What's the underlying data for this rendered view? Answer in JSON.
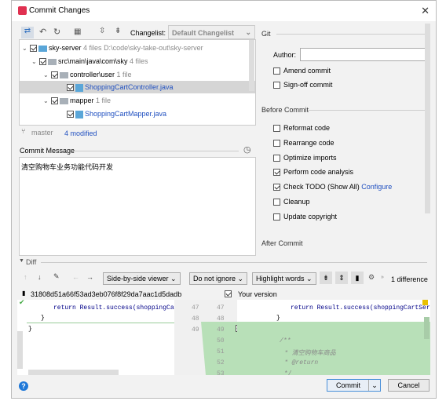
{
  "window": {
    "title": "Commit Changes"
  },
  "toolbar": {
    "changelist_label": "Changelist:",
    "changelist_value": "Default Changelist"
  },
  "tree": [
    {
      "name": "sky-server",
      "meta": "4 files",
      "path": "D:\\code\\sky-take-out\\sky-server"
    },
    {
      "name": "src\\main\\java\\com\\sky",
      "meta": "4 files"
    },
    {
      "name": "controller\\user",
      "meta": "1 file"
    },
    {
      "name": "ShoppingCartController.java"
    },
    {
      "name": "mapper",
      "meta": "1 file"
    },
    {
      "name": "ShoppingCartMapper.java"
    }
  ],
  "status": {
    "branch": "master",
    "modified": "4 modified"
  },
  "commit_message": {
    "label": "Commit Message",
    "value": "清空购物车业务功能代码开发"
  },
  "git": {
    "section": "Git",
    "author_label": "Author:",
    "author_value": "",
    "amend": "Amend commit",
    "signoff": "Sign-off commit"
  },
  "before_commit": {
    "section": "Before Commit",
    "options": [
      {
        "label": "Reformat code",
        "checked": false
      },
      {
        "label": "Rearrange code",
        "checked": false
      },
      {
        "label": "Optimize imports",
        "checked": false
      },
      {
        "label": "Perform code analysis",
        "checked": true
      },
      {
        "label": "Check TODO (Show All)",
        "checked": true,
        "link": "Configure"
      },
      {
        "label": "Cleanup",
        "checked": false
      },
      {
        "label": "Update copyright",
        "checked": false
      }
    ]
  },
  "after_commit": {
    "section": "After Commit"
  },
  "diff": {
    "section": "Diff",
    "viewer": "Side-by-side viewer",
    "ignore": "Do not ignore",
    "highlight": "Highlight words",
    "count": "1 difference",
    "left_title": "31808d51a66f53ad3eb076f8f29da7aac1d5dadb",
    "right_title": "Your version",
    "left_lines": [
      "return Result.success(shoppingCartSer",
      "}",
      "}"
    ],
    "left_nums": [
      "47",
      "48",
      "49"
    ],
    "right_nums": [
      "47",
      "48",
      "49",
      "50",
      "51",
      "52",
      "53"
    ],
    "right_lines": [
      "return Result.success(shoppingCartServic",
      "}",
      "",
      "/**",
      "* 清空购物车商品",
      "* @return",
      "*/"
    ]
  },
  "buttons": {
    "commit": "Commit",
    "cancel": "Cancel",
    "help": "?"
  }
}
